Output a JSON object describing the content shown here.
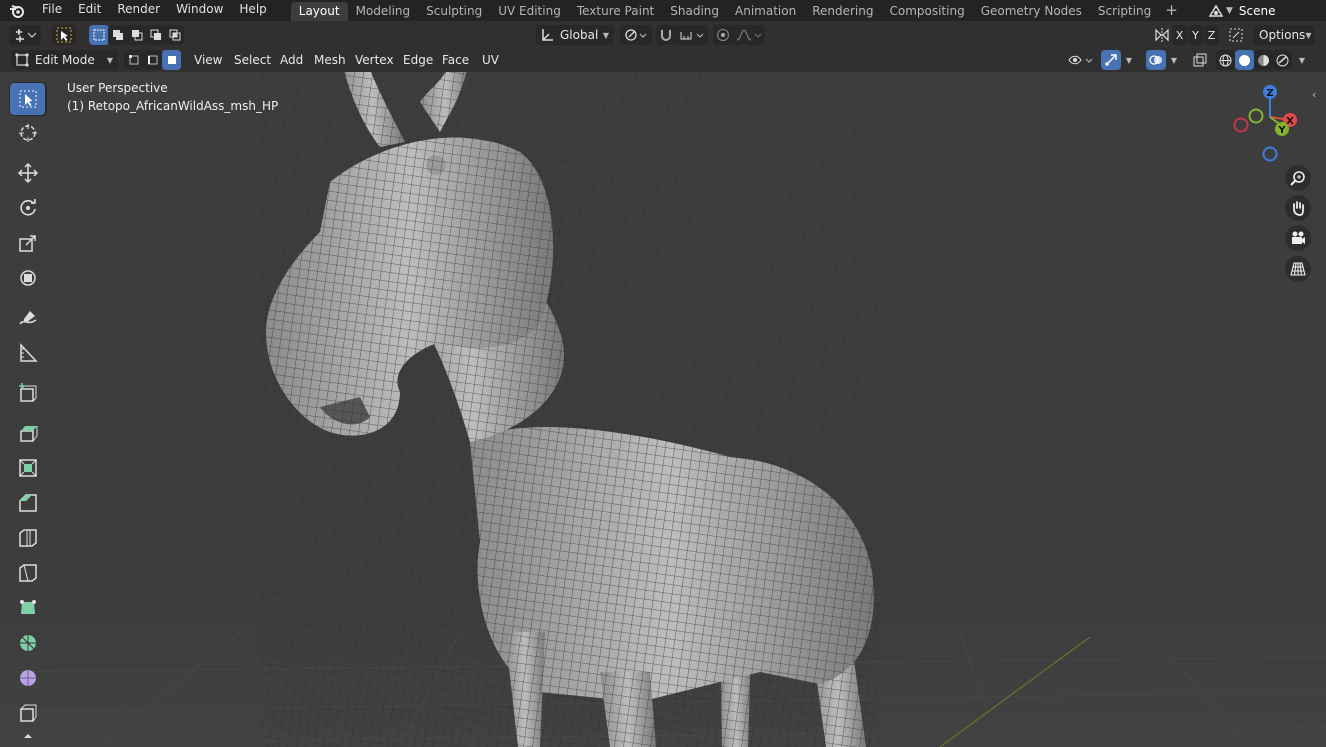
{
  "top_menu": [
    "File",
    "Edit",
    "Render",
    "Window",
    "Help"
  ],
  "workspace_tabs": [
    {
      "label": "Layout",
      "active": true
    },
    {
      "label": "Modeling",
      "active": false
    },
    {
      "label": "Sculpting",
      "active": false
    },
    {
      "label": "UV Editing",
      "active": false
    },
    {
      "label": "Texture Paint",
      "active": false
    },
    {
      "label": "Shading",
      "active": false
    },
    {
      "label": "Animation",
      "active": false
    },
    {
      "label": "Rendering",
      "active": false
    },
    {
      "label": "Compositing",
      "active": false
    },
    {
      "label": "Geometry Nodes",
      "active": false
    },
    {
      "label": "Scripting",
      "active": false
    }
  ],
  "scene_label": "Scene",
  "header": {
    "transform_orientation": "Global",
    "axes": [
      "X",
      "Y",
      "Z"
    ],
    "options_label": "Options",
    "mode": "Edit Mode",
    "menus": [
      "View",
      "Select",
      "Add",
      "Mesh",
      "Vertex",
      "Edge",
      "Face",
      "UV"
    ]
  },
  "viewport": {
    "perspective_label": "User Perspective",
    "object_label": "(1) Retopo_AfricanWildAss_msh_HP"
  },
  "gizmo": {
    "z": "Z",
    "y": "Y",
    "x": "X"
  },
  "tools": [
    "select-box",
    "cursor",
    "move",
    "rotate",
    "scale",
    "transform",
    "annotate",
    "measure",
    "add-cube",
    "extrude-region",
    "inset-faces",
    "bevel",
    "loop-cut",
    "knife",
    "poly-build",
    "spin",
    "smooth",
    "shrink-fatten",
    "shear"
  ],
  "colors": {
    "accent": "#4772b3",
    "axis_x": "#e24a4a",
    "axis_y": "#84b32c",
    "axis_z": "#3e7ee0"
  }
}
